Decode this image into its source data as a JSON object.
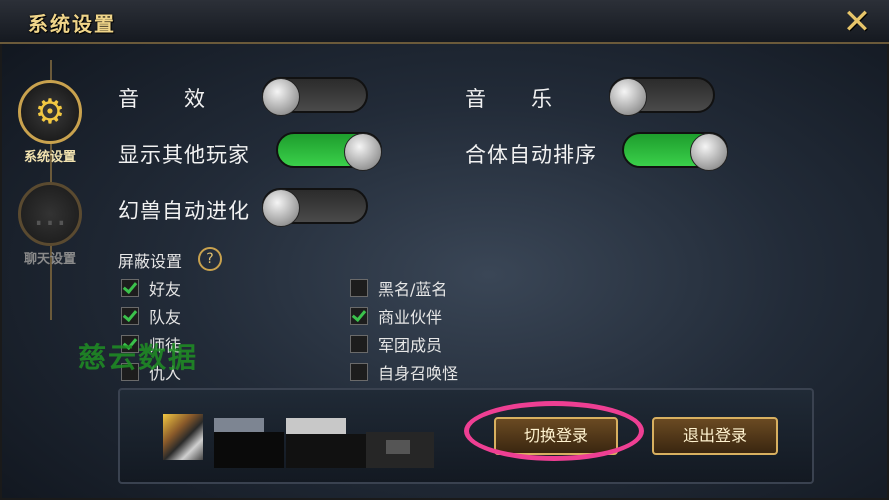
{
  "window": {
    "title": "系统设置",
    "close_glyph": "✕"
  },
  "sidebar": {
    "items": [
      {
        "label": "系统设置",
        "icon": "gear-icon",
        "glyph": "⚙",
        "active": true
      },
      {
        "label": "聊天设置",
        "icon": "chat-bubble-icon",
        "glyph": "…",
        "active": false
      }
    ]
  },
  "settings": {
    "sound_effects": {
      "label": "音　　效",
      "state": "off"
    },
    "music": {
      "label": "音　　乐",
      "state": "off"
    },
    "show_other_players": {
      "label": "显示其他玩家",
      "state": "on"
    },
    "auto_sort_merge": {
      "label": "合体自动排序",
      "state": "on"
    },
    "auto_evolve_beast": {
      "label": "幻兽自动进化",
      "state": "off"
    }
  },
  "block_settings": {
    "header": "屏蔽设置",
    "help_glyph": "?",
    "left": [
      {
        "label": "好友",
        "checked": true
      },
      {
        "label": "队友",
        "checked": true
      },
      {
        "label": "师徒",
        "checked": true
      },
      {
        "label": "仇人",
        "checked": false
      }
    ],
    "right": [
      {
        "label": "黑名/蓝名",
        "checked": false
      },
      {
        "label": "商业伙伴",
        "checked": true
      },
      {
        "label": "军团成员",
        "checked": false
      },
      {
        "label": "自身召唤怪",
        "checked": false
      }
    ]
  },
  "watermark": "慈云数据",
  "account": {
    "switch_login_label": "切换登录",
    "logout_label": "退出登录"
  },
  "colors": {
    "accent_gold": "#c9a24e",
    "toggle_on": "#2fb83d",
    "highlight_ring": "#ee3f93"
  }
}
